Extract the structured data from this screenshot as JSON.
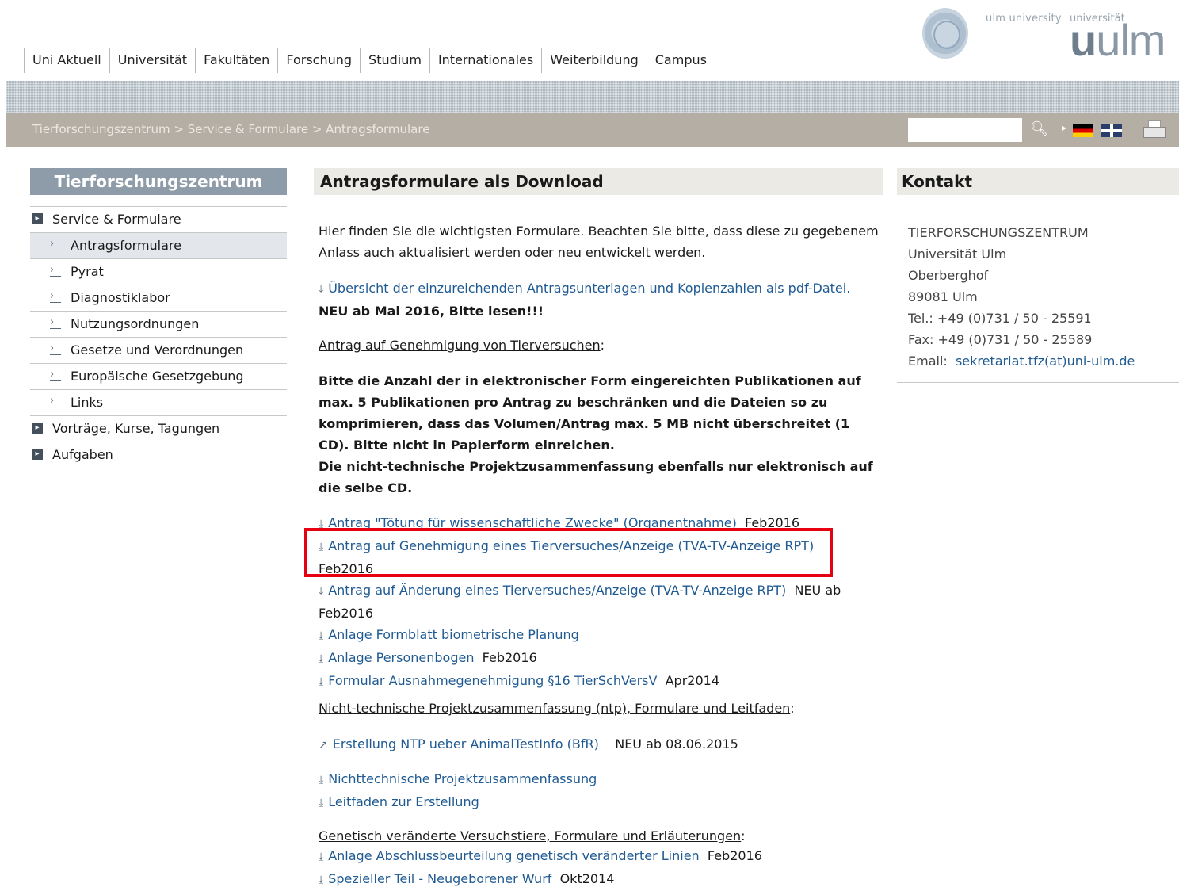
{
  "nav": [
    "Uni Aktuell",
    "Universität",
    "Fakultäten",
    "Forschung",
    "Studium",
    "Internationales",
    "Weiterbildung",
    "Campus"
  ],
  "logo": {
    "small_en": "ulm university",
    "small_de": "universität",
    "big_u": "u",
    "big_ulm": "ulm"
  },
  "breadcrumb": "Tierforschungszentrum > Service & Formulare > Antragsformulare",
  "search": {
    "placeholder": ""
  },
  "sidebar": {
    "title": "Tierforschungszentrum",
    "items": [
      {
        "label": "Service & Formulare",
        "level": "top"
      },
      {
        "label": "Antragsformulare",
        "level": "sub",
        "active": true
      },
      {
        "label": "Pyrat",
        "level": "sub"
      },
      {
        "label": "Diagnostiklabor",
        "level": "sub"
      },
      {
        "label": "Nutzungsordnungen",
        "level": "sub"
      },
      {
        "label": "Gesetze und Verordnungen",
        "level": "sub"
      },
      {
        "label": "Europäische Gesetzgebung",
        "level": "sub"
      },
      {
        "label": "Links",
        "level": "sub"
      },
      {
        "label": "Vorträge, Kurse, Tagungen",
        "level": "top"
      },
      {
        "label": "Aufgaben",
        "level": "top"
      }
    ]
  },
  "main": {
    "title": "Antragsformulare als Download",
    "intro": "Hier finden Sie die wichtigsten Formulare. Beachten Sie bitte, dass diese zu gegebenem Anlass auch aktualisiert werden oder neu entwickelt werden.",
    "overview_link": "Übersicht der einzureichenden Antragsunterlagen und Kopienzahlen als pdf-Datei.",
    "overview_note": "NEU ab Mai 2016, Bitte lesen!!!",
    "section1_heading": "Antrag auf Genehmigung von Tierversuchen",
    "section1_colon": ":",
    "notice1": "Bitte die Anzahl der in elektronischer Form eingereichten Publikationen auf max. 5 Publikationen pro Antrag zu beschränken und die Dateien so zu komprimieren, dass das Volumen/Antrag max. 5 MB nicht überschreitet (1 CD). Bitte nicht in Papierform einreichen.",
    "notice2": "Die nicht-technische Projektzusammenfassung ebenfalls nur elektronisch auf die selbe CD.",
    "forms": [
      {
        "link": "Antrag \"Tötung für wissenschaftliche Zwecke\" (Organentnahme)",
        "note": "Feb2016"
      },
      {
        "link": "Antrag auf Genehmigung eines Tierversuches/Anzeige (TVA-TV-Anzeige RPT)",
        "note": "Feb2016"
      },
      {
        "link": "Antrag auf Änderung eines Tierversuches/Anzeige (TVA-TV-Anzeige RPT)",
        "note": "NEU ab Feb2016"
      },
      {
        "link": "Anlage Formblatt biometrische Planung",
        "note": ""
      },
      {
        "link": "Anlage Personenbogen",
        "note": "Feb2016"
      },
      {
        "link": "Formular Ausnahmegenehmigung §16 TierSchVersV",
        "note": "Apr2014"
      }
    ],
    "section2_heading": "Nicht-technische Projektzusammenfassung (ntp), Formulare und Leitfaden",
    "ntp_external": {
      "link": "Erstellung NTP ueber AnimalTestInfo (BfR)",
      "note": "NEU ab 08.06.2015"
    },
    "ntp_forms": [
      "Nichttechnische Projektzusammenfassung",
      "Leitfaden zur Erstellung"
    ],
    "section3_heading": "Genetisch veränderte Versuchstiere, Formulare und Erläuterungen",
    "gv_forms": [
      {
        "link": "Anlage Abschlussbeurteilung genetisch veränderter Linien",
        "note": "Feb2016"
      },
      {
        "link": "Spezieller Teil - Neugeborener Wurf",
        "note": "Okt2014"
      }
    ]
  },
  "contact": {
    "title": "Kontakt",
    "lines": [
      "TIERFORSCHUNGSZENTRUM",
      "Universität Ulm",
      "Oberberghof",
      "89081 Ulm",
      "Tel.: +49 (0)731 / 50 - 25591",
      "Fax: +49 (0)731 / 50 - 25589"
    ],
    "email_label": "Email:",
    "email": "sekretariat.tfz(at)uni-ulm.de"
  },
  "colors": {
    "accent_link": "#1f5a92",
    "highlight": "#e60012",
    "sidebar_title_bg": "#8e9ca9",
    "crumb_bg": "#b5aea4"
  },
  "icons": {
    "download": "download-icon",
    "external": "external-link-icon",
    "search": "search-icon",
    "print": "print-icon"
  }
}
